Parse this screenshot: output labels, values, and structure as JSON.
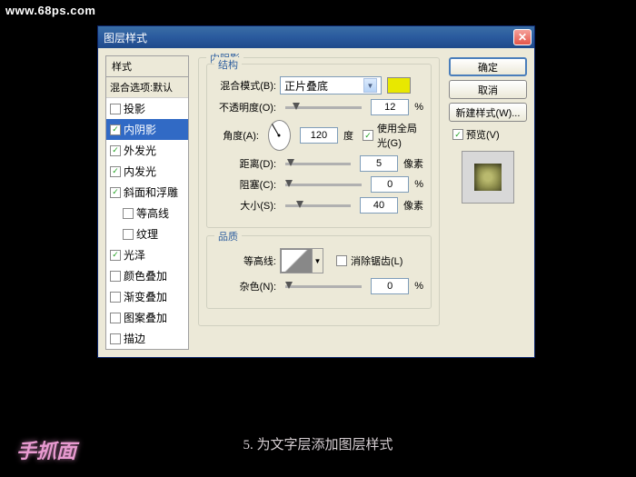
{
  "watermark": "www.68ps.com",
  "dialog": {
    "title": "图层样式"
  },
  "styles": {
    "header": "样式",
    "defaults": "混合选项:默认",
    "items": [
      {
        "label": "投影",
        "checked": false,
        "selected": false
      },
      {
        "label": "内阴影",
        "checked": true,
        "selected": true
      },
      {
        "label": "外发光",
        "checked": true,
        "selected": false
      },
      {
        "label": "内发光",
        "checked": true,
        "selected": false
      },
      {
        "label": "斜面和浮雕",
        "checked": true,
        "selected": false
      },
      {
        "label": "等高线",
        "checked": false,
        "indent": true
      },
      {
        "label": "纹理",
        "checked": false,
        "indent": true
      },
      {
        "label": "光泽",
        "checked": true,
        "selected": false
      },
      {
        "label": "颜色叠加",
        "checked": false,
        "selected": false
      },
      {
        "label": "渐变叠加",
        "checked": false,
        "selected": false
      },
      {
        "label": "图案叠加",
        "checked": false,
        "selected": false
      },
      {
        "label": "描边",
        "checked": false,
        "selected": false
      }
    ]
  },
  "panel": {
    "title": "内阴影",
    "structure": {
      "legend": "结构",
      "blend_label": "混合模式(B):",
      "blend_value": "正片叠底",
      "opacity_label": "不透明度(O):",
      "opacity_value": "12",
      "opacity_unit": "%",
      "angle_label": "角度(A):",
      "angle_value": "120",
      "angle_unit": "度",
      "global_label": "使用全局光(G)",
      "distance_label": "距离(D):",
      "distance_value": "5",
      "distance_unit": "像素",
      "choke_label": "阻塞(C):",
      "choke_value": "0",
      "choke_unit": "%",
      "size_label": "大小(S):",
      "size_value": "40",
      "size_unit": "像素"
    },
    "quality": {
      "legend": "品质",
      "contour_label": "等高线:",
      "antialias_label": "消除锯齿(L)",
      "noise_label": "杂色(N):",
      "noise_value": "0",
      "noise_unit": "%"
    }
  },
  "buttons": {
    "ok": "确定",
    "cancel": "取消",
    "new_style": "新建样式(W)...",
    "preview": "预览(V)"
  },
  "caption": "5. 为文字层添加图层样式",
  "logo": "手抓面"
}
